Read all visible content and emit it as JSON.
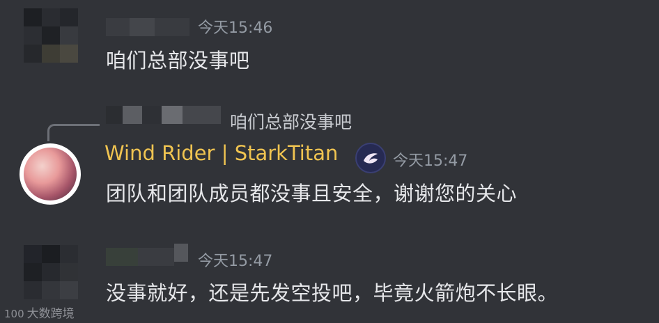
{
  "messages": [
    {
      "id": "m1",
      "timestamp": "今天15:46",
      "text": "咱们总部没事吧"
    },
    {
      "id": "m2",
      "reply_to_text": "咱们总部没事吧",
      "username": "Wind Rider | StarkTitan",
      "timestamp": "今天15:47",
      "text": "团队和团队成员都没事且安全，谢谢您的关心",
      "badge_icon": "brand-logo-icon",
      "name_color": "#f0c451"
    },
    {
      "id": "m3",
      "timestamp": "今天15:47",
      "text": "没事就好，还是先发空投吧，毕竟火箭炮不长眼。"
    }
  ],
  "watermark": {
    "logo": "100",
    "text": "大数跨境"
  },
  "colors": {
    "background": "#313338",
    "timestamp": "#949ba4",
    "message_text": "#e6e7ea"
  }
}
